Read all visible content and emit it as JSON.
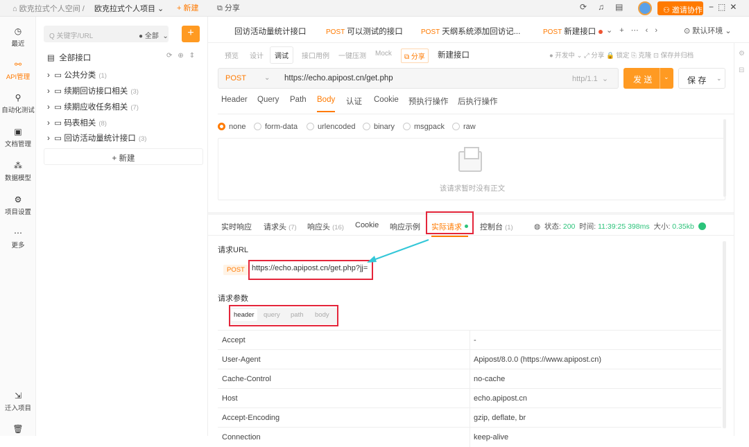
{
  "topbar": {
    "workspace": "欧克拉式个人空间",
    "separator": "/",
    "project": "欧克拉式个人项目",
    "new_label": "+ 新建",
    "share_label": "分享",
    "invite_label": "邀请协作"
  },
  "leftnav": [
    {
      "label": "最近",
      "icon": "clock-icon"
    },
    {
      "label": "API管理",
      "icon": "api-icon"
    },
    {
      "label": "自动化测试",
      "icon": "automation-icon"
    },
    {
      "label": "文档管理",
      "icon": "document-icon"
    },
    {
      "label": "数据模型",
      "icon": "model-icon"
    },
    {
      "label": "项目设置",
      "icon": "settings-icon"
    },
    {
      "label": "更多",
      "icon": "more-icon"
    },
    {
      "label": "迁入项目",
      "icon": "import-icon"
    }
  ],
  "tree": {
    "search_placeholder": "Q 关键字/URL",
    "scope": "● 全部",
    "add": "+",
    "all_interfaces": "全部接口",
    "folders": [
      {
        "name": "公共分类",
        "count": "(1)"
      },
      {
        "name": "续期回访接口相关",
        "count": "(3)"
      },
      {
        "name": "续期应收任务相关",
        "count": "(7)"
      },
      {
        "name": "码表相关",
        "count": "(8)"
      },
      {
        "name": "回访活动量统计接口",
        "count": "(3)"
      }
    ],
    "new_label": "+ 新建"
  },
  "tabs": [
    {
      "method": "",
      "title": "回访活动量统计接口"
    },
    {
      "method": "POST",
      "title": "可以测试的接口"
    },
    {
      "method": "POST",
      "title": "天纲系统添加回访记..."
    },
    {
      "method": "POST",
      "title": "新建接口"
    }
  ],
  "env_label": "⊙ 默认环境",
  "mode_tabs": [
    "预览",
    "设计",
    "调试",
    "接口用例",
    "一键压测",
    "Mock"
  ],
  "mode_share": "分享",
  "request_name": "新建接口",
  "right_controls": "● 开发中  ⌄   ⤢ 分享   🔒 锁定   ⎘ 克隆   ⊡ 保存并归档",
  "request": {
    "method": "POST",
    "url": "https://echo.apipost.cn/get.php",
    "http_version": "http/1.1"
  },
  "send_label": "发 送",
  "save_label": "保 存",
  "sub_tabs": [
    "Header",
    "Query",
    "Path",
    "Body",
    "认证",
    "Cookie",
    "预执行操作",
    "后执行操作"
  ],
  "body_types": [
    "none",
    "form-data",
    "urlencoded",
    "binary",
    "msgpack",
    "raw"
  ],
  "empty_body_text": "该请求暂时没有正文",
  "response_tabs": [
    {
      "label": "实时响应",
      "count": ""
    },
    {
      "label": "请求头",
      "count": "(7)"
    },
    {
      "label": "响应头",
      "count": "(16)"
    },
    {
      "label": "Cookie",
      "count": ""
    },
    {
      "label": "响应示例",
      "count": ""
    },
    {
      "label": "实际请求",
      "count": ""
    },
    {
      "label": "控制台",
      "count": "(1)"
    }
  ],
  "status": {
    "status_label": "状态:",
    "status_value": "200",
    "time_label": "时间:",
    "time_value": "11:39:25 398ms",
    "size_label": "大小:",
    "size_value": "0.35kb"
  },
  "actual_request": {
    "url_label": "请求URL",
    "method": "POST",
    "url": "https://echo.apipost.cn/get.php?jj=",
    "params_label": "请求参数",
    "param_tabs": [
      "header",
      "query",
      "path",
      "body"
    ],
    "headers": [
      {
        "key": "Accept",
        "value": "-"
      },
      {
        "key": "User-Agent",
        "value": "Apipost/8.0.0 (https://www.apipost.cn)"
      },
      {
        "key": "Cache-Control",
        "value": "no-cache"
      },
      {
        "key": "Host",
        "value": "echo.apipost.cn"
      },
      {
        "key": "Accept-Encoding",
        "value": "gzip, deflate, br"
      },
      {
        "key": "Connection",
        "value": "keep-alive"
      }
    ]
  },
  "colors": {
    "accent": "#ff7a00",
    "highlight_box": "#e4253a",
    "arrow": "#33c7d8",
    "success": "#2bc37a"
  }
}
